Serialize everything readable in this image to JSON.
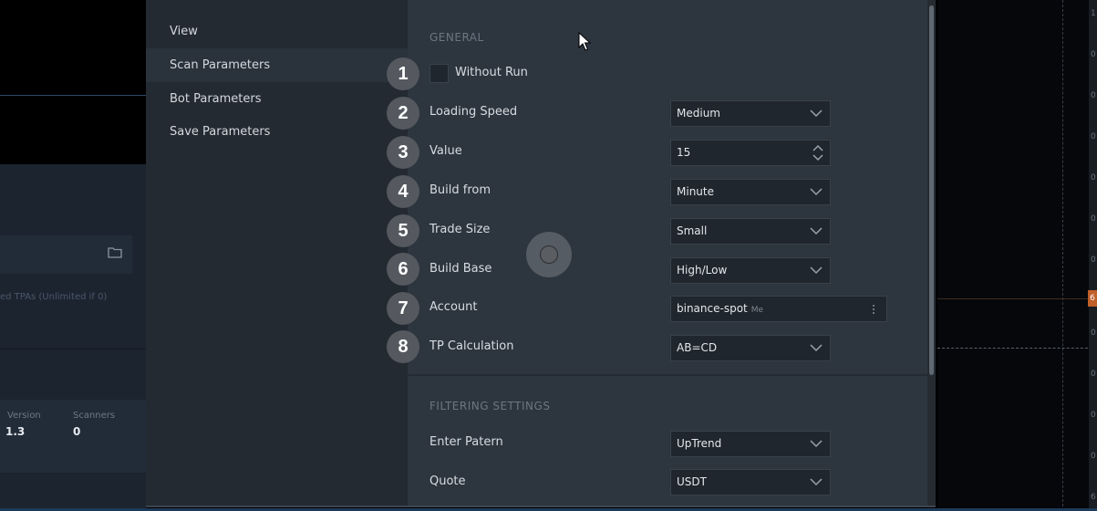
{
  "sidebar": {
    "items": [
      {
        "label": "View"
      },
      {
        "label": "Scan Parameters"
      },
      {
        "label": "Bot Parameters"
      },
      {
        "label": "Save Parameters"
      }
    ]
  },
  "general": {
    "title": "GENERAL",
    "without_run_label": "Without Run",
    "fields": [
      {
        "num": "2",
        "label": "Loading Speed",
        "value": "Medium"
      },
      {
        "num": "3",
        "label": "Value",
        "value": "15"
      },
      {
        "num": "4",
        "label": "Build from",
        "value": "Minute"
      },
      {
        "num": "5",
        "label": "Trade Size",
        "value": "Small"
      },
      {
        "num": "6",
        "label": "Build Base",
        "value": "High/Low"
      },
      {
        "num": "7",
        "label": "Account",
        "value": "binance-spot",
        "tag": "Me"
      },
      {
        "num": "8",
        "label": "TP Calculation",
        "value": "AB=CD"
      }
    ]
  },
  "filtering": {
    "title": "FILTERING SETTINGS",
    "fields": [
      {
        "label": "Enter Patern",
        "value": "UpTrend"
      },
      {
        "label": "Quote",
        "value": "USDT"
      }
    ]
  },
  "steps": {
    "first": "1"
  },
  "background": {
    "faint_text": "ed TPAs (Unlimited if 0)",
    "stat1_label": "Version",
    "stat1_value": "1.3",
    "stat2_label": "Scanners",
    "stat2_value": "0",
    "badge": "6",
    "ticks": [
      "1",
      "0",
      "0",
      "0",
      "0",
      "0",
      "0",
      "0",
      "0",
      "0",
      "0",
      "6"
    ]
  },
  "colors": {
    "dialog_bg": "#2d353e",
    "sidebar_bg": "#232a32",
    "accent_badge": "#c0602a"
  }
}
